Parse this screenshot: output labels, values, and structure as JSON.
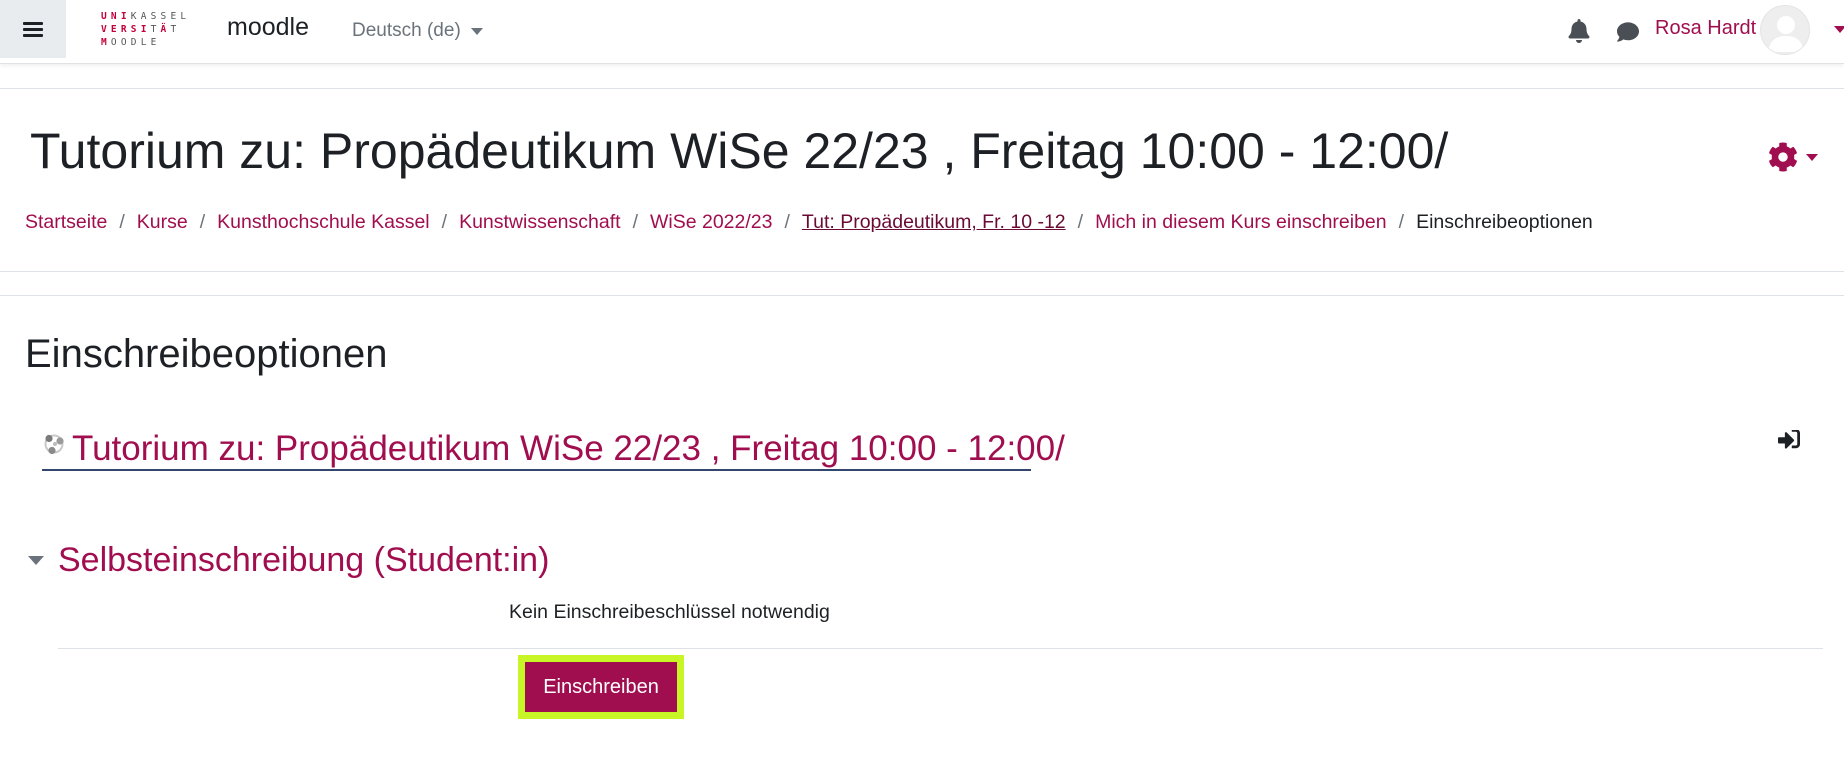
{
  "navbar": {
    "logo_rows": [
      [
        "U",
        "N",
        "I",
        "K",
        "A",
        "S",
        "S",
        "E",
        "L"
      ],
      [
        "V",
        "E",
        "R",
        "S",
        "I",
        "T",
        "Ä",
        "T"
      ],
      [
        "M",
        "O",
        "O",
        "D",
        "L",
        "E"
      ]
    ],
    "brand": "moodle",
    "language": "Deutsch (de)",
    "user_name": "Rosa Hardt"
  },
  "header": {
    "title": "Tutorium zu: Propädeutikum WiSe 22/23 , Freitag 10:00 - 12:00/",
    "breadcrumb": [
      "Startseite",
      "Kurse",
      "Kunsthochschule Kassel",
      "Kunstwissenschaft",
      "WiSe 2022/23",
      "Tut: Propädeutikum, Fr. 10 -12",
      "Mich in diesem Kurs einschreiben",
      "Einschreibeoptionen"
    ],
    "breadcrumb_separator": "/"
  },
  "main": {
    "heading": "Einschreibeoptionen",
    "course_link": "Tutorium zu: Propädeutikum WiSe 22/23 , Freitag 10:00 - 12:00/",
    "self_enrolment": {
      "heading": "Selbsteinschreibung (Student:in)",
      "key_info": "Kein Einschreibeschlüssel notwendig",
      "button_label": "Einschreiben"
    }
  },
  "colors": {
    "accent": "#a10e4f",
    "highlight": "#c8f526",
    "drawer_bg": "#e9ecef"
  },
  "icons": {
    "drawer": "hamburger-icon",
    "notifications": "bell-icon",
    "messages": "chat-icon",
    "settings": "gear-icon",
    "enrol": "sign-in-icon",
    "course": "course-icon"
  }
}
